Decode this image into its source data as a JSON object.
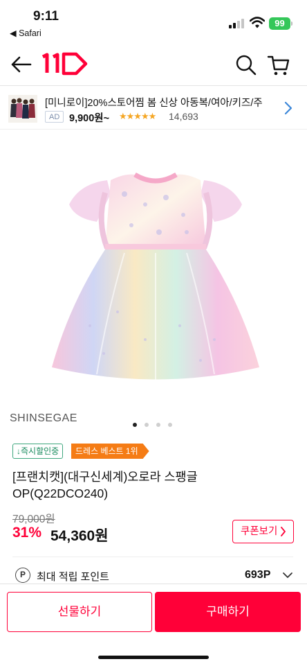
{
  "status_bar": {
    "time": "9:11",
    "back_app": "◀ Safari",
    "battery": "99"
  },
  "nav": {
    "logo_text": "11",
    "brand_color": "#ff0038"
  },
  "ad_banner": {
    "title": "[미니로이]20%스토어찜 봄 신상 아동복/여아/키즈/주",
    "badge": "AD",
    "price": "9,900원~",
    "rating_stars": "★★★★★",
    "reviews": "14,693"
  },
  "product": {
    "brand": "SHINSEGAE",
    "image_count": 4,
    "image_index": 0,
    "badges": {
      "instant_discount": "↓즉시할인중",
      "best": "드레스 베스트 1위"
    },
    "title": "[프랜치캣](대구신세계)오로라 스팽글 OP(Q22DCO240)",
    "original_price": "79,000원",
    "discount_rate": "31%",
    "price": "54,360원",
    "coupon_button": "쿠폰보기",
    "point_icon": "P",
    "point_label": "최대 적립 포인트",
    "point_value": "693P"
  },
  "bottom_bar": {
    "gift_button": "선물하기",
    "buy_button": "구매하기"
  },
  "colors": {
    "accent": "#ff0038",
    "best_badge": "#f57c15",
    "discount_badge": "#178a5c"
  }
}
